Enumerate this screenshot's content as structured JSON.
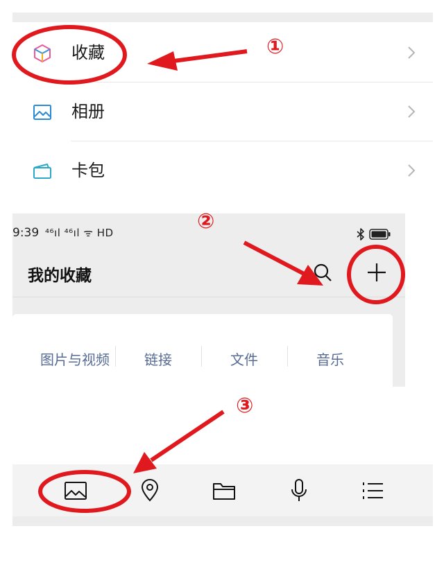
{
  "menu": {
    "items": [
      {
        "label": "收藏",
        "icon": "favorites-cube-icon"
      },
      {
        "label": "相册",
        "icon": "album-picture-icon"
      },
      {
        "label": "卡包",
        "icon": "card-wallet-icon"
      }
    ]
  },
  "favorites": {
    "status_bar": {
      "time": "9:39",
      "signals": "⁴⁶ıl ⁴⁶ıl ᯤ HD"
    },
    "title": "我的收藏",
    "tabs": [
      "图片与视频",
      "链接",
      "文件",
      "音乐"
    ]
  },
  "toolbar": {
    "buttons": [
      "picture-icon",
      "location-icon",
      "folder-icon",
      "microphone-icon",
      "list-icon"
    ]
  },
  "annotations": {
    "step1": "①",
    "step2": "②",
    "step3": "③",
    "color": "#e0191e"
  }
}
